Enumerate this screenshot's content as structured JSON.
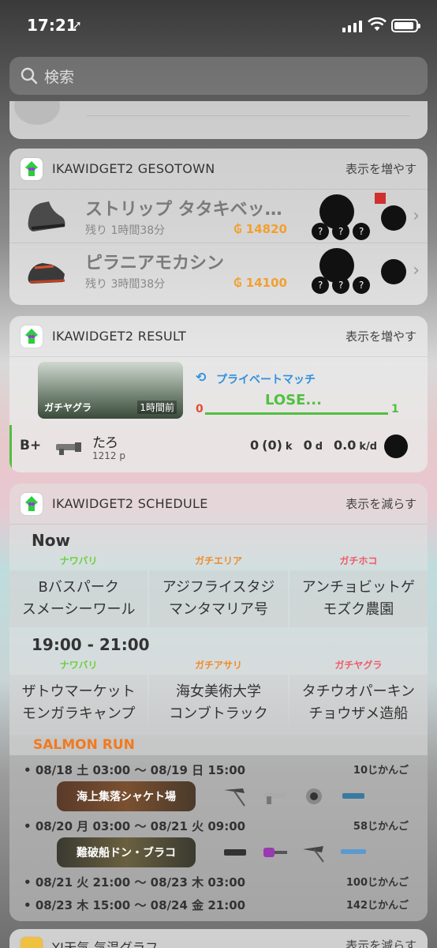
{
  "status": {
    "time": "17:21",
    "location_icon": "location-arrow-icon"
  },
  "search": {
    "placeholder": "検索"
  },
  "gesotown": {
    "title": "IKAWIDGET2 GESOTOWN",
    "more": "表示を増やす",
    "items": [
      {
        "name": "ストリップ タタキベッ…",
        "remaining": "残り 1時間38分",
        "price": "₲ 14820"
      },
      {
        "name": "ピラニアモカシン",
        "remaining": "残り 3時間38分",
        "price": "₲ 14100"
      }
    ]
  },
  "result": {
    "title": "IKAWIDGET2 RESULT",
    "more": "表示を増やす",
    "stage": "ガチヤグラ",
    "time_ago": "1時間前",
    "match_type": "プライベートマッチ",
    "outcome": "LOSE...",
    "score_left": "0",
    "score_right": "1",
    "rank": "B+",
    "player": "たろ",
    "points": "1212 p",
    "kills": "0",
    "assists": "(0)",
    "k_label": "k",
    "deaths": "0",
    "d_label": "d",
    "kd": "0.0",
    "kd_label": "k/d"
  },
  "schedule": {
    "title": "IKAWIDGET2 SCHEDULE",
    "more": "表示を減らす",
    "now_label": "Now",
    "now": [
      {
        "mode": "ナワバリ",
        "color": "#6bd03b",
        "stage1": "Bバスパーク",
        "stage2": "スメーシーワール"
      },
      {
        "mode": "ガチエリア",
        "color": "#f08a2a",
        "stage1": "アジフライスタジ",
        "stage2": "マンタマリア号"
      },
      {
        "mode": "ガチホコ",
        "color": "#f05a6a",
        "stage1": "アンチョビットゲ",
        "stage2": "モズク農園"
      }
    ],
    "next_label": "19:00 - 21:00",
    "next": [
      {
        "mode": "ナワバリ",
        "color": "#6bd03b",
        "stage1": "ザトウマーケット",
        "stage2": "モンガラキャンプ"
      },
      {
        "mode": "ガチアサリ",
        "color": "#f08a2a",
        "stage1": "海女美術大学",
        "stage2": "コンブトラック"
      },
      {
        "mode": "ガチヤグラ",
        "color": "#f05a6a",
        "stage1": "タチウオパーキン",
        "stage2": "チョウザメ造船"
      }
    ],
    "salmon_label": "SALMON RUN",
    "salmon": [
      {
        "period": "08/18 土 03:00 〜 08/19 日 15:00",
        "remaining": "10じかんご",
        "stage": "海上集落シャケト場"
      },
      {
        "period": "08/20 月 03:00 〜 08/21 火 09:00",
        "remaining": "58じかんご",
        "stage": "難破船ドン・ブラコ"
      },
      {
        "period": "08/21 火 21:00 〜 08/23 木 03:00",
        "remaining": "100じかんご"
      },
      {
        "period": "08/23 木 15:00 〜 08/24 金 21:00",
        "remaining": "142じかんご"
      }
    ]
  },
  "bottom_widget": {
    "title": "YJ天気 気温グラフ",
    "more": "表示を減らす"
  }
}
